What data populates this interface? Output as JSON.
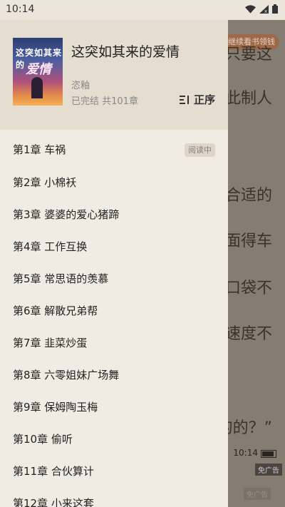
{
  "status_bar": {
    "time": "10:14"
  },
  "reader": {
    "banner": "继续看书领钱",
    "lines": [
      "只要这",
      "此制人",
      "合适的",
      "面得车",
      "口袋不",
      "速度不",
      "的的？”"
    ],
    "clock": "10:14",
    "ad_label": "免广告",
    "ad_label2": "免广告"
  },
  "book": {
    "title": "这突如其来的爱情",
    "author": "恣釉",
    "status": "已完结 共101章",
    "cover_title": "这突如其来的",
    "cover_sub": "爱情",
    "sort_label": "正序"
  },
  "chapters": [
    {
      "label": "第1章 车祸",
      "badge": "阅读中"
    },
    {
      "label": "第2章 小棉袄"
    },
    {
      "label": "第3章 婆婆的爱心猪蹄"
    },
    {
      "label": "第4章 工作互换"
    },
    {
      "label": "第5章 常思语的羡慕"
    },
    {
      "label": "第6章 解散兄弟帮"
    },
    {
      "label": "第7章 韭菜炒蛋"
    },
    {
      "label": "第8章 六零姐妹广场舞"
    },
    {
      "label": "第9章 保姆陶玉梅"
    },
    {
      "label": "第10章 偷听"
    },
    {
      "label": "第11章 合伙算计"
    },
    {
      "label": "第12章 小来这套"
    }
  ]
}
